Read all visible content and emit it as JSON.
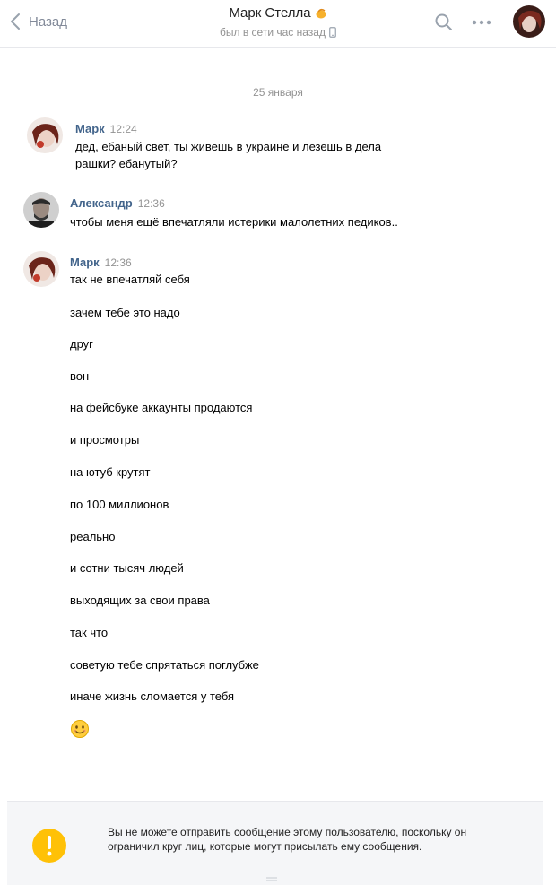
{
  "header": {
    "back_label": "Назад",
    "title": "Марк Стелла",
    "status": "был в сети час назад"
  },
  "date_separator": "25 января",
  "messages": [
    {
      "author": "Марк",
      "time": "12:24",
      "lines": [
        "дед, ебаный свет, ты живешь в украине и лезешь в дела",
        "рашки? ебанутый?"
      ]
    },
    {
      "author": "Александр",
      "time": "12:36",
      "lines": [
        "чтобы меня ещё впечатляли истерики малолетних педиков.."
      ]
    },
    {
      "author": "Марк",
      "time": "12:36",
      "lines": [
        "так не впечатляй себя",
        "зачем тебе это надо",
        "друг",
        "вон",
        "на фейсбуке аккаунты продаются",
        "и просмотры",
        "на ютуб крутят",
        "по 100 миллионов",
        "реально",
        "и сотни тысяч людей",
        "выходящих за свои права",
        "так что",
        "советую тебе спрятаться поглубже",
        "иначе жизнь сломается у тебя"
      ]
    }
  ],
  "footer": {
    "notice": "Вы не можете отправить сообщение этому пользователю, поскольку он ограничил круг лиц, которые могут присылать ему сообщения."
  },
  "colors": {
    "author_link": "#42648b",
    "warning": "#ffc107",
    "meta_text": "#939393"
  },
  "icons": {
    "back": "chevron-left-icon",
    "search": "search-icon",
    "more": "more-dots-icon",
    "phone": "mobile-phone-icon",
    "warning": "warning-icon",
    "emoji": "smiling-face-emoji"
  }
}
